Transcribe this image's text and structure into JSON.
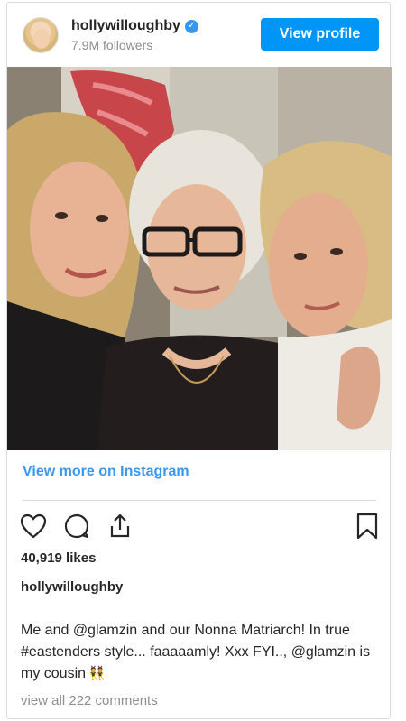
{
  "header": {
    "username": "hollywilloughby",
    "verified_icon": "✓",
    "followers": "7.9M followers",
    "view_profile_label": "View profile"
  },
  "photo": {
    "description_icon": "group-selfie-photo"
  },
  "link": {
    "label": "View more on Instagram"
  },
  "actions": {
    "like_icon": "heart-icon",
    "comment_icon": "comment-icon",
    "share_icon": "share-icon",
    "save_icon": "bookmark-icon"
  },
  "post": {
    "likes": "40,919 likes",
    "username": "hollywilloughby",
    "caption": "Me and @glamzin and our Nonna Matriarch! In true #eastenders style... faaaaamly! Xxx FYI.., @glamzin is my cousin",
    "caption_emoji": "👯",
    "view_comments": "view all 222 comments"
  },
  "colors": {
    "accent": "#0095f6",
    "link": "#3897f0",
    "muted": "#8e8e8e",
    "border": "#dbdbdb"
  }
}
